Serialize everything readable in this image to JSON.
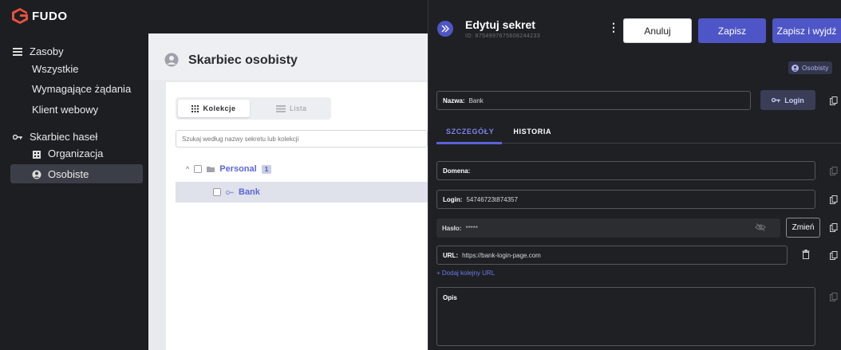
{
  "app": {
    "name": "FUDO"
  },
  "sidebar": {
    "resources": {
      "label": "Zasoby",
      "items": [
        "Wszystkie",
        "Wymagające żądania",
        "Klient webowy"
      ]
    },
    "vault": {
      "label": "Skarbiec haseł",
      "items": [
        {
          "label": "Organizacja",
          "icon": "building-icon"
        },
        {
          "label": "Osobiste",
          "icon": "user-circle-icon"
        }
      ]
    }
  },
  "main": {
    "title": "Skarbiec osobisty",
    "view_toggle": {
      "collections": "Kolekcje",
      "list": "Lista"
    },
    "search_placeholder": "Szukaj według nazwy sekretu lub kolekcji",
    "tree": {
      "collection": {
        "name": "Personal",
        "count": "1"
      },
      "secret": {
        "name": "Bank"
      }
    }
  },
  "drawer": {
    "title": "Edytuj sekret",
    "secret_id": "ID: 8754997675608244233",
    "cancel_label": "Anuluj",
    "save_label": "Zapisz",
    "save_exit_label": "Zapisz i wyjdź",
    "owner_badge": "Osobisty",
    "name_field": {
      "label": "Nazwa:",
      "value": "Bank"
    },
    "login_button": "Login",
    "tabs": [
      "SZCZEGÓŁY",
      "HISTORIA"
    ],
    "domain_field": {
      "label": "Domena:",
      "value": ""
    },
    "login_field": {
      "label": "Login:",
      "value": "54746723t874357"
    },
    "password_field": {
      "label": "Hasło:",
      "value": "*****"
    },
    "change_button": "Zmień",
    "url_field": {
      "label": "URL:",
      "value": "https://bank-login-page.com"
    },
    "add_url": "+ Dodaj kolejny URL",
    "description_label": "Opis"
  },
  "colors": {
    "accent": "#4e55c7",
    "sidebar_bg": "#1d1e22",
    "drawer_bg": "#1f2024"
  }
}
